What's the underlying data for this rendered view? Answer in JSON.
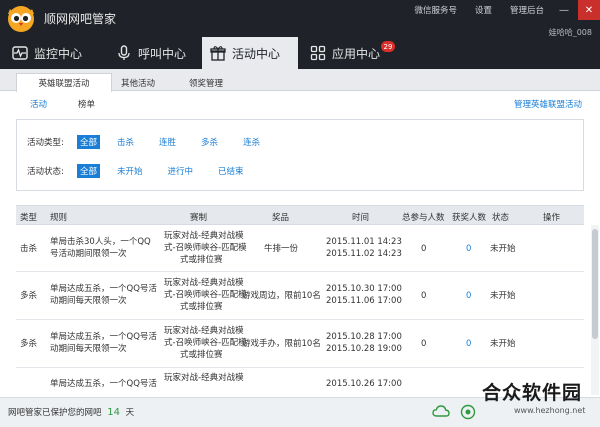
{
  "app": {
    "title": "顺网网吧管家",
    "top_links": [
      "微信服务号",
      "设置",
      "管理后台"
    ],
    "username": "娃哈哈_008"
  },
  "nav": {
    "items": [
      {
        "label": "监控中心",
        "icon": "pulse-icon"
      },
      {
        "label": "呼叫中心",
        "icon": "microphone-icon"
      },
      {
        "label": "活动中心",
        "icon": "gift-icon"
      },
      {
        "label": "应用中心",
        "icon": "apps-grid-icon",
        "badge": "29"
      }
    ],
    "active_index": 2
  },
  "subtabs": [
    "英雄联盟活动",
    "其他活动",
    "领奖管理"
  ],
  "inner_tabs": [
    "活动",
    "榜单"
  ],
  "manage_link": "管理英雄联盟活动",
  "filters": {
    "type_label": "活动类型:",
    "type_options": [
      "全部",
      "击杀",
      "连胜",
      "多杀",
      "连杀"
    ],
    "status_label": "活动状态:",
    "status_options": [
      "全部",
      "未开始",
      "进行中",
      "已结束"
    ]
  },
  "table": {
    "headers": [
      "类型",
      "规则",
      "赛制",
      "奖品",
      "时间",
      "总参与人数",
      "获奖人数",
      "状态",
      "操作"
    ],
    "rows": [
      {
        "type": "击杀",
        "rule": [
          "单局击杀30人头，一个QQ",
          "号活动期间限领一次"
        ],
        "format": [
          "玩家对战-经典对战模",
          "式-召唤师峡谷-匹配模",
          "式或排位赛"
        ],
        "prize": "牛排一份",
        "time": [
          "2015.11.01 14:23",
          "2015.11.02 14:23"
        ],
        "participants": "0",
        "winners": "0",
        "status": "未开始"
      },
      {
        "type": "多杀",
        "rule": [
          "单局达成五杀，一个QQ号活",
          "动期间每天限领一次"
        ],
        "format": [
          "玩家对战-经典对战模",
          "式-召唤师峡谷-匹配模",
          "式或排位赛"
        ],
        "prize": "游戏周边，限前10名",
        "time": [
          "2015.10.30 17:00",
          "2015.11.06 17:00"
        ],
        "participants": "0",
        "winners": "0",
        "status": "未开始"
      },
      {
        "type": "多杀",
        "rule": [
          "单局达成五杀，一个QQ号活",
          "动期间每天限领一次"
        ],
        "format": [
          "玩家对战-经典对战模",
          "式-召唤师峡谷-匹配模",
          "式或排位赛"
        ],
        "prize": "游戏手办，限前10名",
        "time": [
          "2015.10.28 17:00",
          "2015.10.28 19:00"
        ],
        "participants": "0",
        "winners": "0",
        "status": "未开始"
      },
      {
        "rule": [
          "单局达成五杀，一个QQ号活"
        ],
        "format": [
          "玩家对战-经典对战模"
        ],
        "time": [
          "2015.10.26 17:00"
        ]
      }
    ]
  },
  "statusbar": {
    "prefix": "网吧管家已保护您的网吧",
    "days": "14",
    "suffix": "天"
  },
  "watermark": {
    "title": "合众软件园",
    "url": "www.hezhong.net"
  },
  "colors": {
    "dark_bg": "#1f2329",
    "accent_blue": "#1a7ed6",
    "badge_red": "#d9302a",
    "days_green": "#2e9a3e"
  }
}
